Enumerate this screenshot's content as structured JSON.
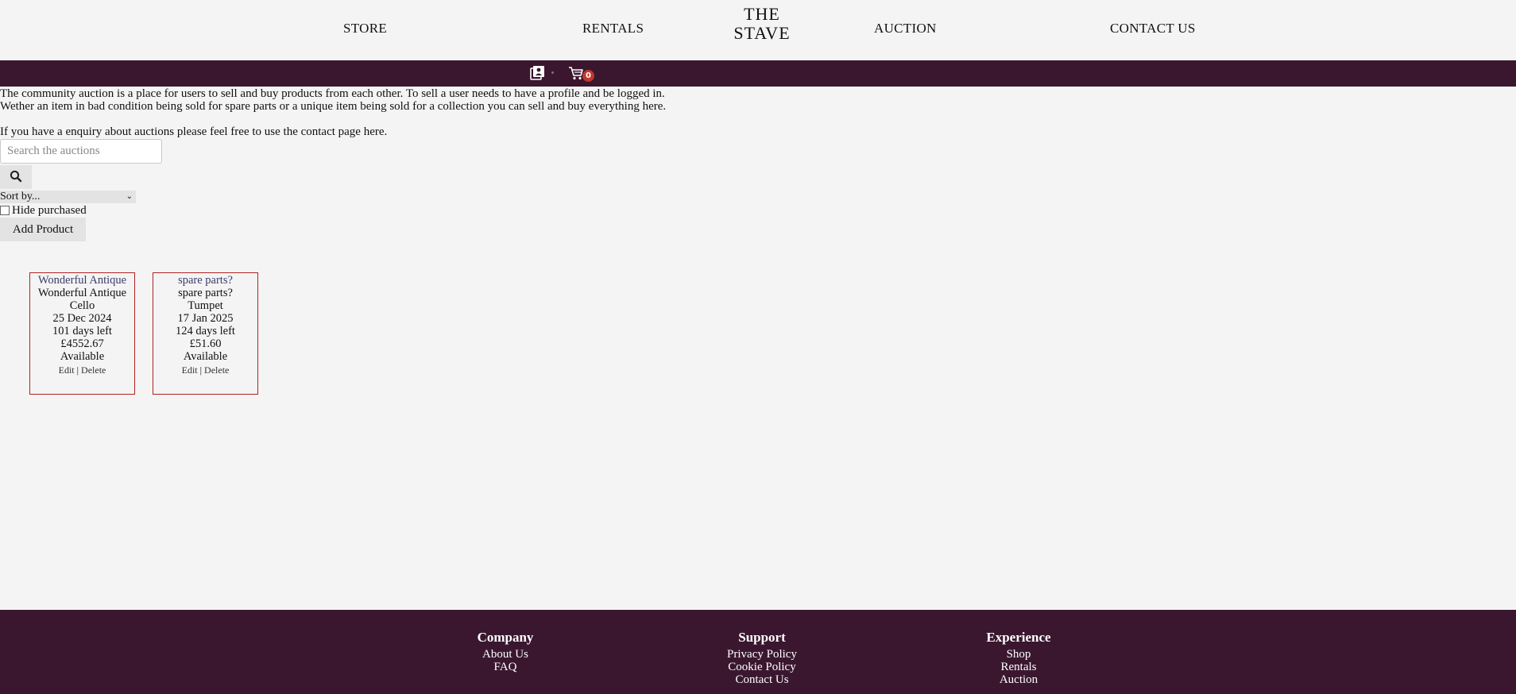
{
  "nav": {
    "store": "STORE",
    "rentals": "RENTALS",
    "brand_line1": "THE",
    "brand_line2": "STAVE",
    "auction": "AUCTION",
    "contact": "CONTACT US"
  },
  "toolbar": {
    "profile_icon": "profile-icon",
    "cart_icon": "cart-icon",
    "cart_count": "0",
    "bar_color": "#3a172f",
    "badge_color": "#c0392b"
  },
  "intro": {
    "line1": "The community auction is a place for users to sell and buy products from each other. To sell a user needs to have a profile and be logged in.",
    "line2": "Wether an item in bad condition being sold for spare parts or a unique item being sold for a collection you can sell and buy everything here.",
    "line3": "If you have a enquiry about auctions please feel free to use the contact page here."
  },
  "controls": {
    "search_placeholder": "Search the auctions",
    "search_icon": "search-icon",
    "sort_selected": "Sort by...",
    "hide_purchased_label": "Hide purchased",
    "hide_purchased_checked": false,
    "add_product_label": "Add Product"
  },
  "auctions": [
    {
      "title_link": "Wonderful Antique",
      "title": "Wonderful Antique",
      "instrument": "Cello",
      "date": "25 Dec 2024",
      "days_left": "101 days left",
      "price": "£4552.67",
      "status": "Available",
      "edit": "Edit",
      "separator": "|",
      "delete": "Delete"
    },
    {
      "title_link": "spare parts?",
      "title": "spare parts?",
      "instrument": "Tumpet",
      "date": "17 Jan 2025",
      "days_left": "124 days left",
      "price": "£51.60",
      "status": "Available",
      "edit": "Edit",
      "separator": "|",
      "delete": "Delete"
    }
  ],
  "footer": {
    "company": {
      "heading": "Company",
      "links": [
        "About Us",
        "FAQ"
      ]
    },
    "support": {
      "heading": "Support",
      "links": [
        "Privacy Policy",
        "Cookie Policy",
        "Contact Us"
      ]
    },
    "experience": {
      "heading": "Experience",
      "links": [
        "Shop",
        "Rentals",
        "Auction"
      ]
    }
  }
}
